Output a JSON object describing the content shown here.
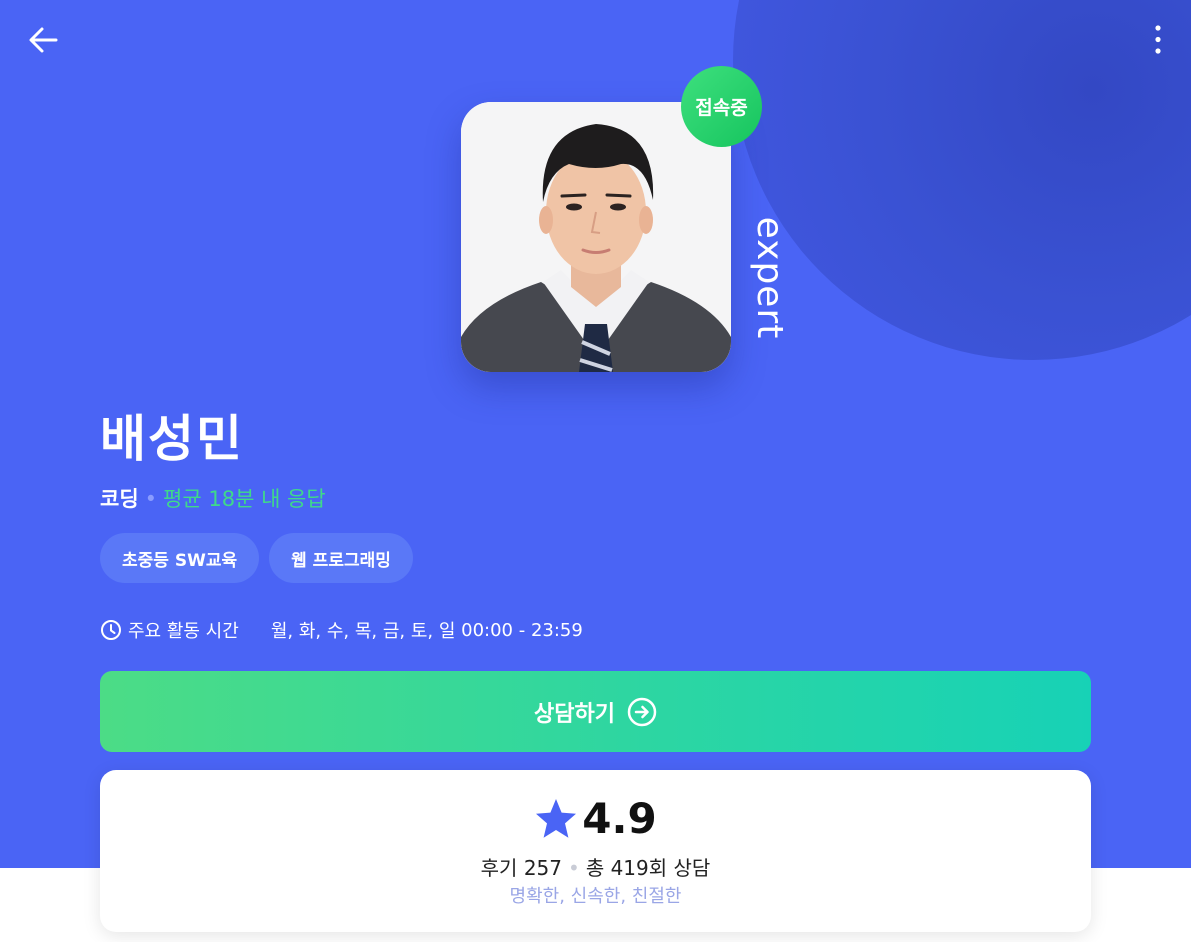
{
  "header": {
    "back_icon": "arrow-left-icon",
    "more_icon": "more-vertical-icon"
  },
  "profile": {
    "status_badge": "접속중",
    "brand_label": "expert",
    "name": "배성민",
    "category": "코딩",
    "separator": "•",
    "response_time": "평균 18분 내 응답",
    "tags": [
      "초중등 SW교육",
      "웹 프로그래밍"
    ]
  },
  "schedule": {
    "icon": "clock-icon",
    "label": "주요 활동 시간",
    "days": "월, 화, 수, 목, 금, 토, 일",
    "hours": "00:00 - 23:59"
  },
  "cta": {
    "label": "상담하기",
    "icon": "arrow-right-circle-icon"
  },
  "rating": {
    "icon": "star-icon",
    "score": "4.9",
    "reviews_label": "후기",
    "reviews_count": "257",
    "separator": "•",
    "total_prefix": "총",
    "total_count": "419",
    "total_suffix": "회 상담",
    "keywords": "명확한, 신속한, 친절한"
  },
  "colors": {
    "hero_bg": "#4a64f5",
    "accent_green": "#3fd98a",
    "tag_bg": "#5a78f7",
    "star": "#4a64f5"
  }
}
